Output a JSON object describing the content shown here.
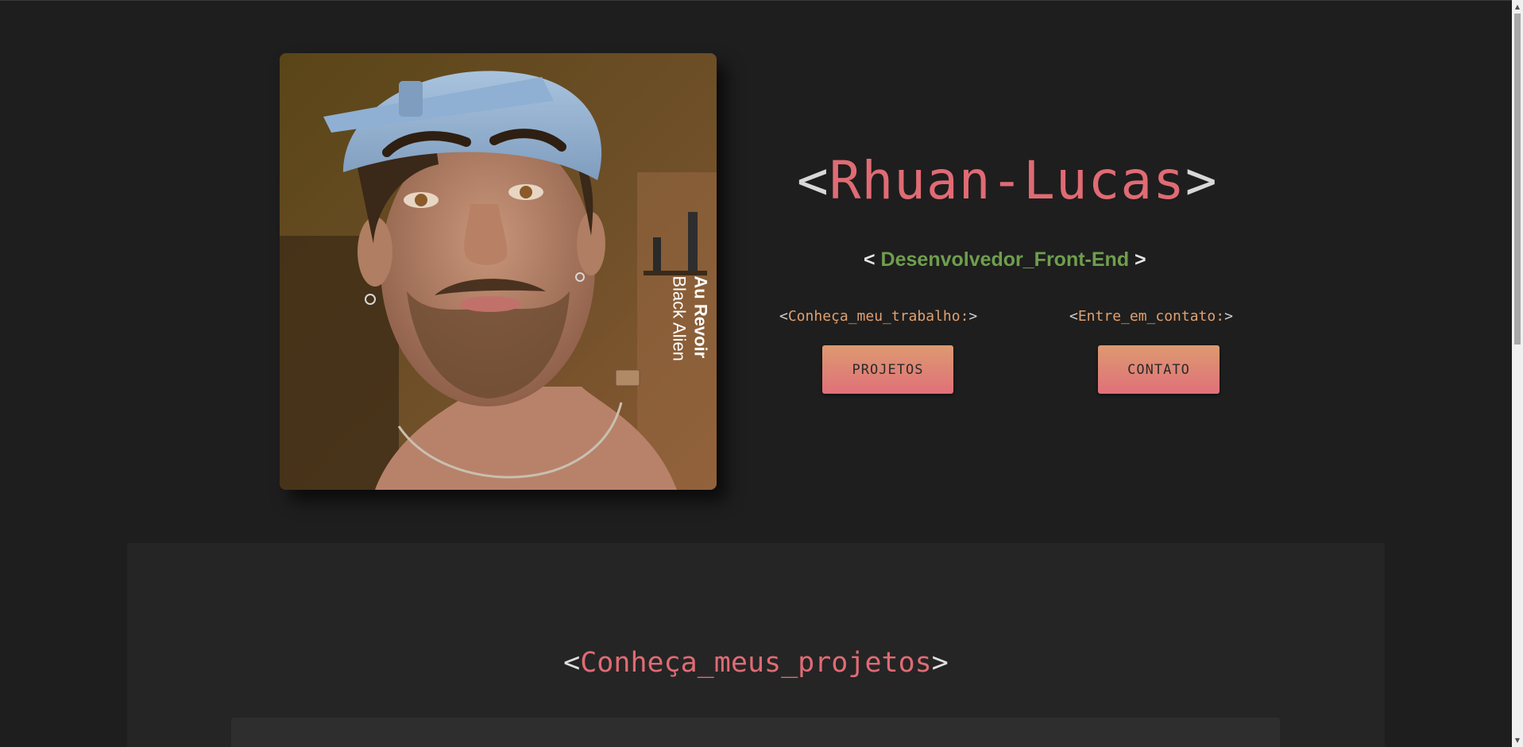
{
  "hero": {
    "photo": {
      "caption_line1": "Au Revoir",
      "caption_line2": "Black Alien"
    },
    "title": {
      "open": "<",
      "name": "Rhuan-Lucas",
      "close": ">"
    },
    "subtitle": {
      "open": "< ",
      "role": "Desenvolvedor_Front-End",
      "close": " >"
    },
    "cta_projects": {
      "open": "<",
      "label": "Conheça_meu_trabalho:",
      "close": ">",
      "button": "PROJETOS"
    },
    "cta_contact": {
      "open": "<",
      "label": "Entre_em_contato:",
      "close": ">",
      "button": "CONTATO"
    }
  },
  "projects_section": {
    "title": {
      "open": "<",
      "text": "Conheça_meus_projetos",
      "close": ">"
    }
  },
  "colors": {
    "background": "#1e1e1e",
    "panel": "#252525",
    "accent_red": "#e06b74",
    "accent_green": "#6f9e4e",
    "accent_orange": "#e0a070",
    "button_gradient_top": "#dd9a70",
    "button_gradient_bottom": "#e0707a"
  },
  "icons": {
    "scroll_up": "triangle-up-icon",
    "scroll_down": "triangle-down-icon"
  }
}
